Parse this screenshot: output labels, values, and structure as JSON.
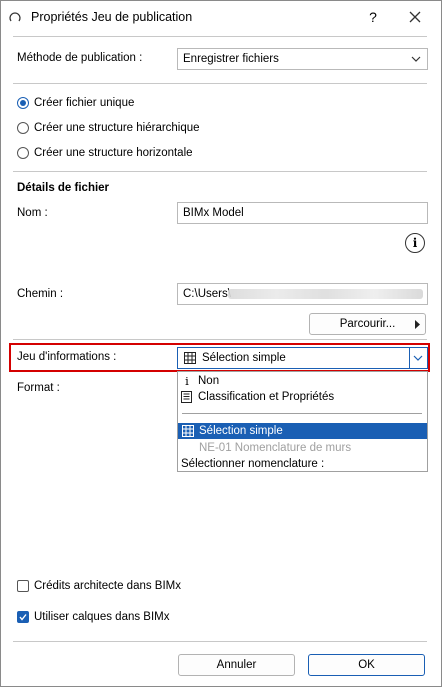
{
  "window": {
    "title": "Propriétés Jeu de publication",
    "help_label": "?"
  },
  "publication_method": {
    "label": "Méthode de publication :",
    "value": "Enregistrer fichiers"
  },
  "structure_options": [
    {
      "label": "Créer fichier unique",
      "checked": true
    },
    {
      "label": "Créer une structure hiérarchique",
      "checked": false
    },
    {
      "label": "Créer une structure horizontale",
      "checked": false
    }
  ],
  "file_details": {
    "heading": "Détails de fichier",
    "name_label": "Nom :",
    "name_value": "BIMx Model",
    "info_icon": "info-icon",
    "path_label": "Chemin :",
    "path_value": "C:\\Users\\",
    "browse_label": "Parcourir..."
  },
  "info_set": {
    "label": "Jeu d'informations :",
    "value": "Sélection simple",
    "options": [
      {
        "label": "Non",
        "icon": "info-i-icon",
        "state": "normal"
      },
      {
        "label": "Classification et Propriétés",
        "icon": "document-icon",
        "state": "normal"
      },
      {
        "label": "Sélection simple",
        "icon": "grid-icon",
        "state": "selected"
      },
      {
        "label": "NE-01 Nomenclature de murs",
        "icon": "",
        "state": "disabled"
      },
      {
        "label": "Sélectionner nomenclature :",
        "icon": "",
        "state": "normal"
      }
    ]
  },
  "format": {
    "label": "Format :"
  },
  "checkboxes": [
    {
      "label": "Crédits architecte dans BIMx",
      "checked": false
    },
    {
      "label": "Utiliser calques dans BIMx",
      "checked": true
    }
  ],
  "buttons": {
    "cancel": "Annuler",
    "ok": "OK"
  },
  "colors": {
    "accent": "#1a5fb4",
    "highlight_border": "#d40000"
  }
}
